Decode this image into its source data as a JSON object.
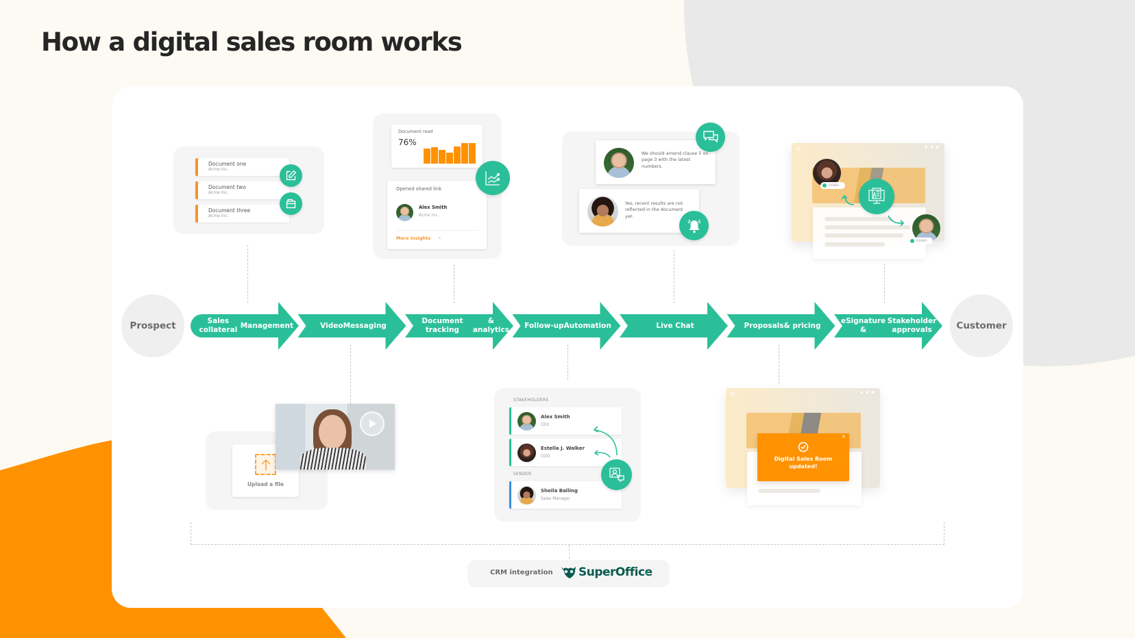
{
  "page": {
    "title": "How a digital sales room works"
  },
  "colors": {
    "accent_green": "#2bbf99",
    "accent_orange": "#fe9200",
    "background": "#fdfaf3",
    "endpoint_gray": "#efefef",
    "crm_brand_green": "#0a5b50"
  },
  "flow": {
    "start": "Prospect",
    "end": "Customer",
    "stages": [
      {
        "line1": "Sales collateral",
        "line2": "Management"
      },
      {
        "line1": "Video",
        "line2": "Messaging"
      },
      {
        "line1": "Document tracking",
        "line2": "& analytics"
      },
      {
        "line1": "Follow-up",
        "line2": "Automation"
      },
      {
        "line1": "Live Chat",
        "line2": ""
      },
      {
        "line1": "Proposals",
        "line2": "& pricing"
      },
      {
        "line1": "eSignature &",
        "line2": "Stakeholder approvals"
      }
    ]
  },
  "collateral": {
    "documents": [
      {
        "title": "Document one",
        "company": "Acme Inc."
      },
      {
        "title": "Document two",
        "company": "Acme Inc."
      },
      {
        "title": "Document three",
        "company": "Acme Inc."
      }
    ],
    "icons": [
      "edit-icon",
      "folder-icon"
    ]
  },
  "tracking": {
    "metric_label": "Document read",
    "metric_value": "76%",
    "bars": [
      0.55,
      0.6,
      0.5,
      0.4,
      0.62,
      0.75,
      0.75
    ],
    "link_label": "Opened shared link",
    "contact_name": "Alex Smith",
    "contact_company": "Acme Inc.",
    "more_link": "More Insights",
    "icon": "analytics-chart-icon"
  },
  "live_chat": {
    "message_1": "We should amend clause 5 on page 3 with the latest numbers.",
    "message_2": "Yes, recent results are not reflected in the document yet.",
    "icons": [
      "chat-bubbles-icon",
      "bell-icon"
    ]
  },
  "esign": {
    "signer_label": "SIGNER",
    "icon": "document-monitor-icon"
  },
  "video": {
    "upload_label": "Upload a file",
    "icon": "play-icon"
  },
  "followup": {
    "stakeholders_label": "STAKEHOLDERS",
    "stakeholders": [
      {
        "name": "Alex Smith",
        "role": "CEO"
      },
      {
        "name": "Estella J. Walker",
        "role": "COO"
      }
    ],
    "sender_label": "SENDER",
    "sender": {
      "name": "Sheila Balling",
      "role": "Sales Manager"
    },
    "icon": "contact-chat-icon"
  },
  "proposals": {
    "notification": "Digital Sales Room updated!"
  },
  "crm": {
    "label": "CRM integration",
    "brand": "SuperOffice",
    "brand_suffix": "."
  }
}
